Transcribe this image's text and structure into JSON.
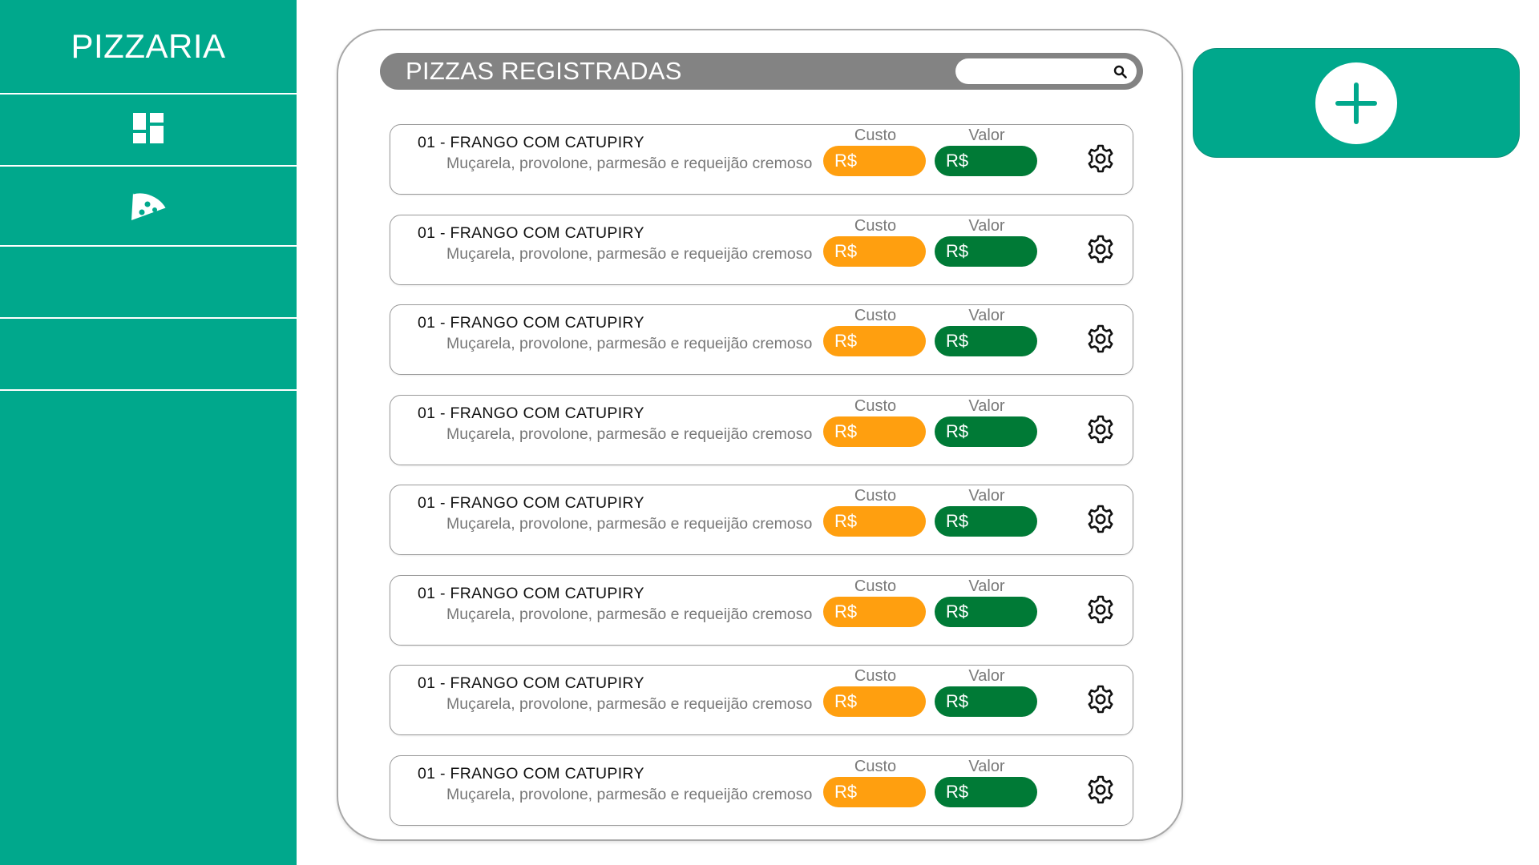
{
  "colors": {
    "sidebar": "#00a88c",
    "header_bar": "#838383",
    "custo_pill": "#ff9f0f",
    "valor_pill": "#007a36",
    "add_button": "#00a88c"
  },
  "sidebar": {
    "title": "PIZZARIA",
    "items": [
      {
        "icon": "dashboard-icon"
      },
      {
        "icon": "pizza-icon"
      },
      {
        "icon": ""
      },
      {
        "icon": ""
      }
    ]
  },
  "panel": {
    "title": "PIZZAS REGISTRADAS",
    "search": {
      "placeholder": "",
      "value": "",
      "icon": "search-icon"
    }
  },
  "pizzas": [
    {
      "title": "01 - FRANGO COM CATUPIRY",
      "description": "Muçarela, provolone, parmesão e requeijão cremoso",
      "custo_label": "Custo",
      "custo_value": "R$",
      "valor_label": "Valor",
      "valor_value": "R$"
    },
    {
      "title": "01 - FRANGO COM CATUPIRY",
      "description": "Muçarela, provolone, parmesão e requeijão cremoso",
      "custo_label": "Custo",
      "custo_value": "R$",
      "valor_label": "Valor",
      "valor_value": "R$"
    },
    {
      "title": "01 - FRANGO COM CATUPIRY",
      "description": "Muçarela, provolone, parmesão e requeijão cremoso",
      "custo_label": "Custo",
      "custo_value": "R$",
      "valor_label": "Valor",
      "valor_value": "R$"
    },
    {
      "title": "01 - FRANGO COM CATUPIRY",
      "description": "Muçarela, provolone, parmesão e requeijão cremoso",
      "custo_label": "Custo",
      "custo_value": "R$",
      "valor_label": "Valor",
      "valor_value": "R$"
    },
    {
      "title": "01 - FRANGO COM CATUPIRY",
      "description": "Muçarela, provolone, parmesão e requeijão cremoso",
      "custo_label": "Custo",
      "custo_value": "R$",
      "valor_label": "Valor",
      "valor_value": "R$"
    },
    {
      "title": "01 - FRANGO COM CATUPIRY",
      "description": "Muçarela, provolone, parmesão e requeijão cremoso",
      "custo_label": "Custo",
      "custo_value": "R$",
      "valor_label": "Valor",
      "valor_value": "R$"
    },
    {
      "title": "01 - FRANGO COM CATUPIRY",
      "description": "Muçarela, provolone, parmesão e requeijão cremoso",
      "custo_label": "Custo",
      "custo_value": "R$",
      "valor_label": "Valor",
      "valor_value": "R$"
    },
    {
      "title": "01 - FRANGO COM CATUPIRY",
      "description": "Muçarela, provolone, parmesão e requeijão cremoso",
      "custo_label": "Custo",
      "custo_value": "R$",
      "valor_label": "Valor",
      "valor_value": "R$"
    }
  ],
  "add_button": {
    "icon": "plus-icon"
  }
}
